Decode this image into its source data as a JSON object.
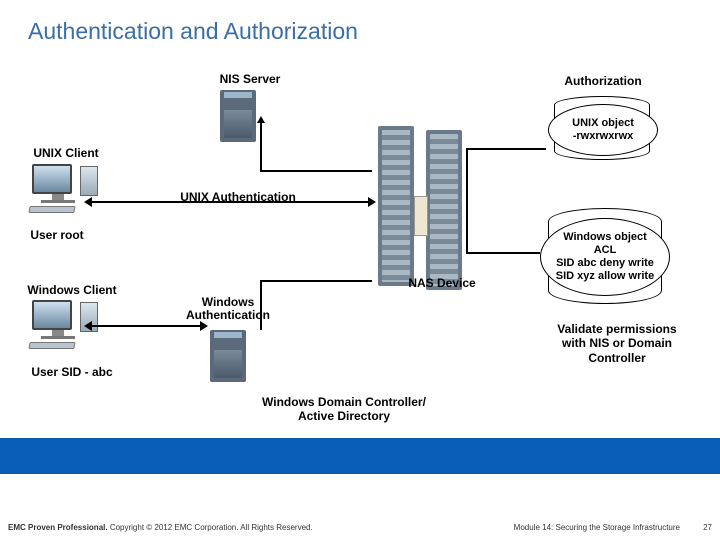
{
  "title": "Authentication and Authorization",
  "nis_server": "NIS Server",
  "authorization": "Authorization",
  "unix_object": {
    "l1": "UNIX object",
    "l2": "-rwxrwxrwx"
  },
  "unix_client": "UNIX Client",
  "unix_auth": "UNIX Authentication",
  "user_root": "User root",
  "windows_client": "Windows Client",
  "windows_auth": "Windows\nAuthentication",
  "user_sid": "User SID - abc",
  "nas_device": "NAS Device",
  "windows_object": {
    "l1": "Windows object",
    "l2": "ACL",
    "l3": "SID abc deny write",
    "l4": "SID xyz allow write"
  },
  "validate": "Validate permissions with NIS or Domain Controller",
  "wdc": "Windows Domain Controller/\nActive Directory",
  "footer": {
    "bold": "EMC Proven Professional.",
    "rest": " Copyright © 2012 EMC Corporation. All Rights Reserved."
  },
  "module": "Module 14: Securing the Storage Infrastructure",
  "page": "27"
}
